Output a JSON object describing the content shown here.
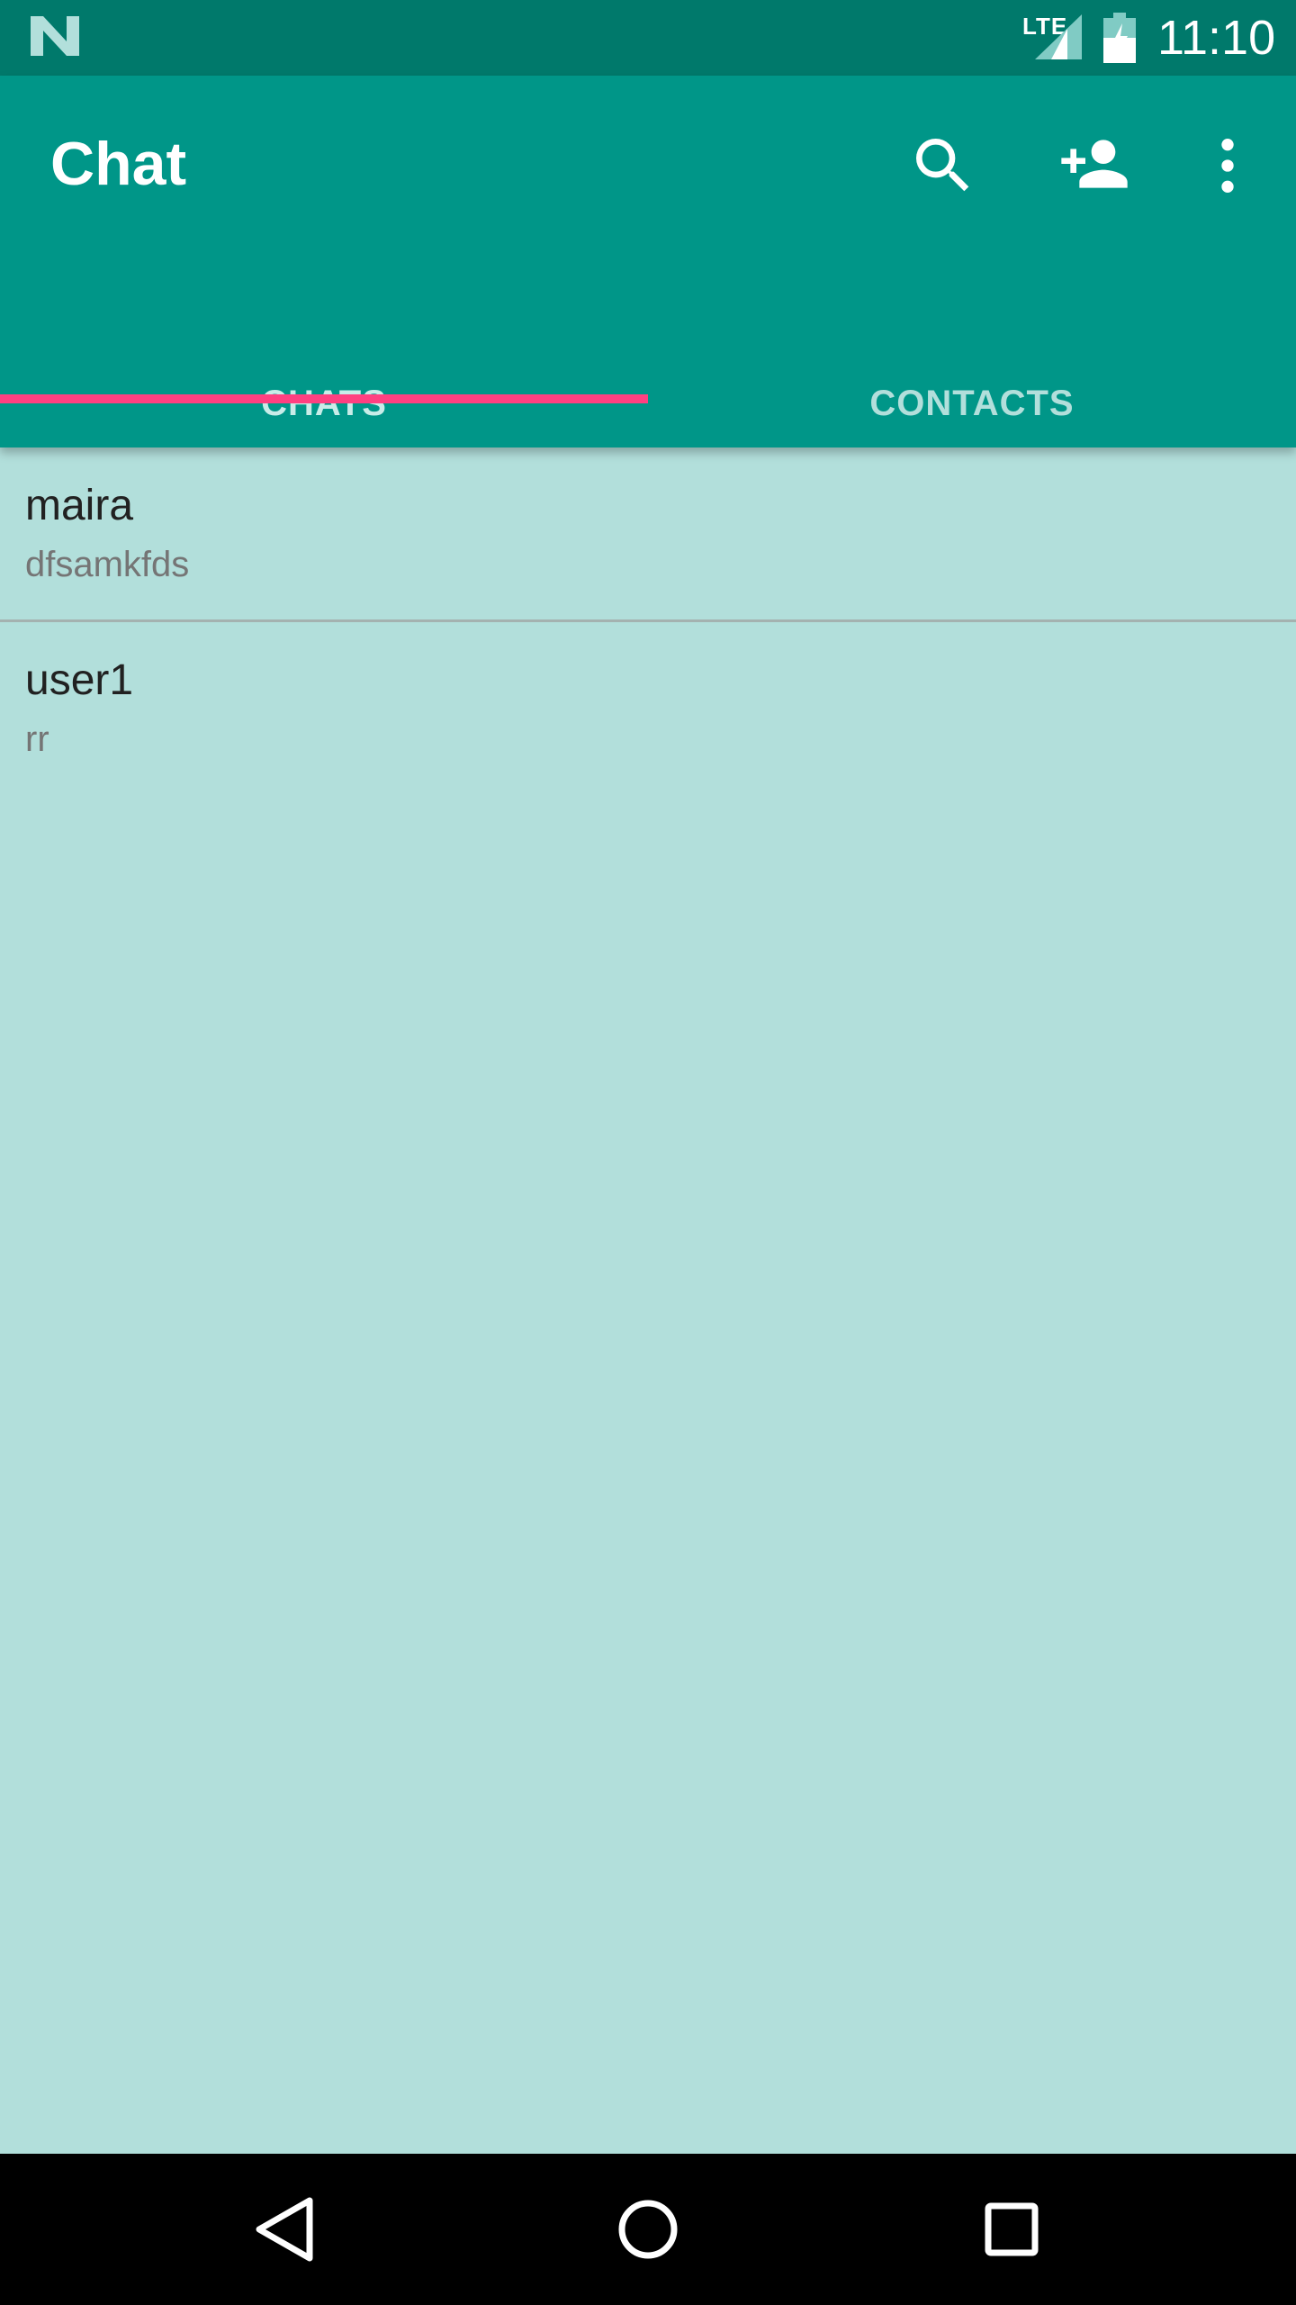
{
  "status_bar": {
    "network": "LTE",
    "time": "11:10",
    "icons": [
      "n-logo-icon",
      "signal-icon",
      "battery-icon"
    ]
  },
  "app_bar": {
    "title": "Chat",
    "actions": [
      "search-icon",
      "add-person-icon",
      "more-vert-icon"
    ],
    "background_color": "#009688"
  },
  "tabs": [
    {
      "label": "CHATS",
      "selected": true
    },
    {
      "label": "CONTACTS",
      "selected": false
    }
  ],
  "tab_indicator_color": "#ff4081",
  "chats": [
    {
      "name": "maira",
      "preview": "dfsamkfds"
    },
    {
      "name": "user1",
      "preview": "rr"
    }
  ],
  "nav_bar": {
    "buttons": [
      "back-icon",
      "home-icon",
      "recents-icon"
    ]
  }
}
